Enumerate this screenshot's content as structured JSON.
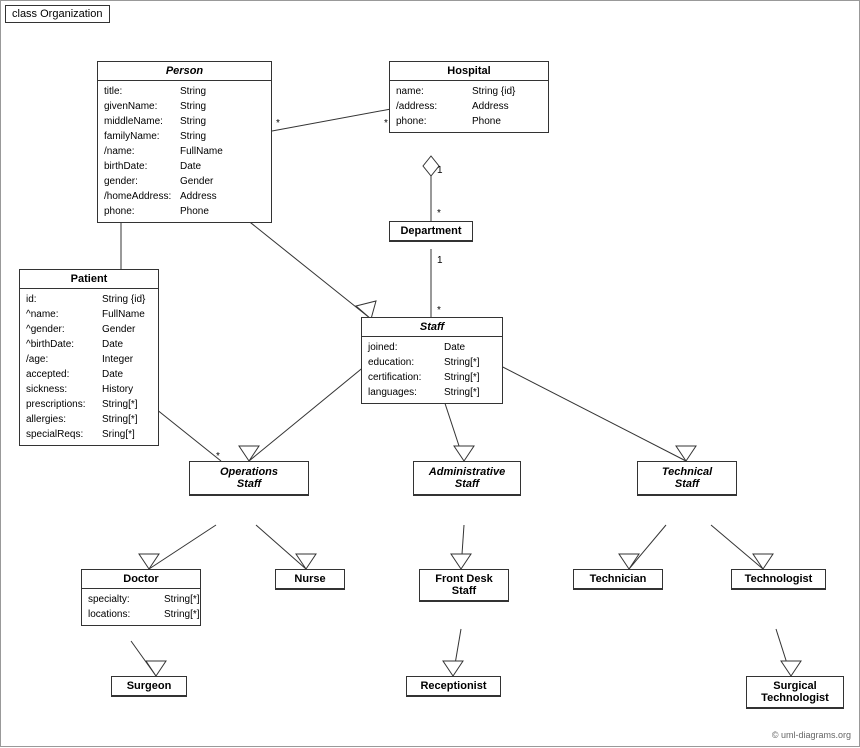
{
  "diagram": {
    "title": "class Organization",
    "copyright": "© uml-diagrams.org",
    "classes": {
      "person": {
        "name": "Person",
        "italic": true,
        "attributes": [
          {
            "name": "title:",
            "type": "String"
          },
          {
            "name": "givenName:",
            "type": "String"
          },
          {
            "name": "middleName:",
            "type": "String"
          },
          {
            "name": "familyName:",
            "type": "String"
          },
          {
            "name": "/name:",
            "type": "FullName"
          },
          {
            "name": "birthDate:",
            "type": "Date"
          },
          {
            "name": "gender:",
            "type": "Gender"
          },
          {
            "name": "/homeAddress:",
            "type": "Address"
          },
          {
            "name": "phone:",
            "type": "Phone"
          }
        ]
      },
      "hospital": {
        "name": "Hospital",
        "attributes": [
          {
            "name": "name:",
            "type": "String {id}"
          },
          {
            "name": "/address:",
            "type": "Address"
          },
          {
            "name": "phone:",
            "type": "Phone"
          }
        ]
      },
      "department": {
        "name": "Department"
      },
      "staff": {
        "name": "Staff",
        "italic": true,
        "attributes": [
          {
            "name": "joined:",
            "type": "Date"
          },
          {
            "name": "education:",
            "type": "String[*]"
          },
          {
            "name": "certification:",
            "type": "String[*]"
          },
          {
            "name": "languages:",
            "type": "String[*]"
          }
        ]
      },
      "patient": {
        "name": "Patient",
        "attributes": [
          {
            "name": "id:",
            "type": "String {id}"
          },
          {
            "name": "^name:",
            "type": "FullName"
          },
          {
            "name": "^gender:",
            "type": "Gender"
          },
          {
            "name": "^birthDate:",
            "type": "Date"
          },
          {
            "name": "/age:",
            "type": "Integer"
          },
          {
            "name": "accepted:",
            "type": "Date"
          },
          {
            "name": "sickness:",
            "type": "History"
          },
          {
            "name": "prescriptions:",
            "type": "String[*]"
          },
          {
            "name": "allergies:",
            "type": "String[*]"
          },
          {
            "name": "specialReqs:",
            "type": "Sring[*]"
          }
        ]
      },
      "operationsStaff": {
        "name": "Operations\nStaff",
        "italic": true
      },
      "administrativeStaff": {
        "name": "Administrative\nStaff",
        "italic": true
      },
      "technicalStaff": {
        "name": "Technical\nStaff",
        "italic": true
      },
      "doctor": {
        "name": "Doctor",
        "attributes": [
          {
            "name": "specialty:",
            "type": "String[*]"
          },
          {
            "name": "locations:",
            "type": "String[*]"
          }
        ]
      },
      "nurse": {
        "name": "Nurse"
      },
      "frontDeskStaff": {
        "name": "Front Desk\nStaff"
      },
      "technician": {
        "name": "Technician"
      },
      "technologist": {
        "name": "Technologist"
      },
      "surgeon": {
        "name": "Surgeon"
      },
      "receptionist": {
        "name": "Receptionist"
      },
      "surgicalTechnologist": {
        "name": "Surgical\nTechnologist"
      }
    }
  }
}
